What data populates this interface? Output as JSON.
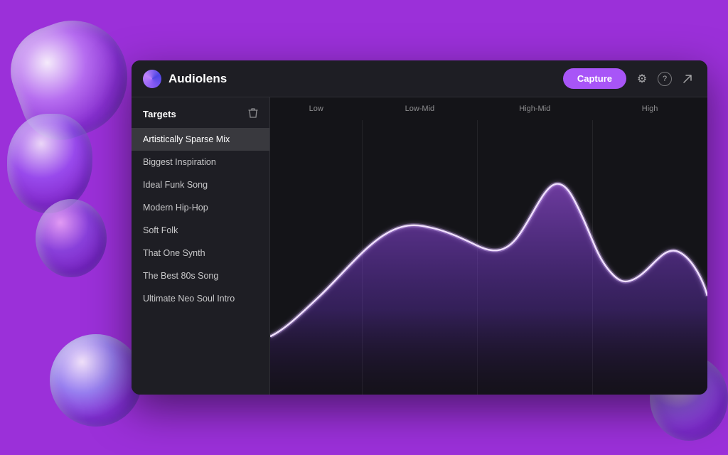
{
  "app": {
    "title": "Audiolens",
    "capture_label": "Capture"
  },
  "sidebar": {
    "title": "Targets",
    "items": [
      {
        "id": "artistically-sparse",
        "label": "Artistically Sparse Mix",
        "active": true
      },
      {
        "id": "biggest-inspiration",
        "label": "Biggest Inspiration",
        "active": false
      },
      {
        "id": "ideal-funk-song",
        "label": "Ideal Funk Song",
        "active": false
      },
      {
        "id": "modern-hip-hop",
        "label": "Modern Hip-Hop",
        "active": false
      },
      {
        "id": "soft-folk",
        "label": "Soft Folk",
        "active": false
      },
      {
        "id": "that-one-synth",
        "label": "That One Synth",
        "active": false
      },
      {
        "id": "the-best-80s-song",
        "label": "The Best 80s Song",
        "active": false
      },
      {
        "id": "ultimate-neo-soul",
        "label": "Ultimate Neo Soul Intro",
        "active": false
      }
    ]
  },
  "chart": {
    "columns": [
      "Low",
      "Low-Mid",
      "High-Mid",
      "High"
    ],
    "accent_color": "#a855f7"
  },
  "icons": {
    "settings": "⚙",
    "help": "?",
    "arrow": "↗",
    "delete": "🗑"
  }
}
